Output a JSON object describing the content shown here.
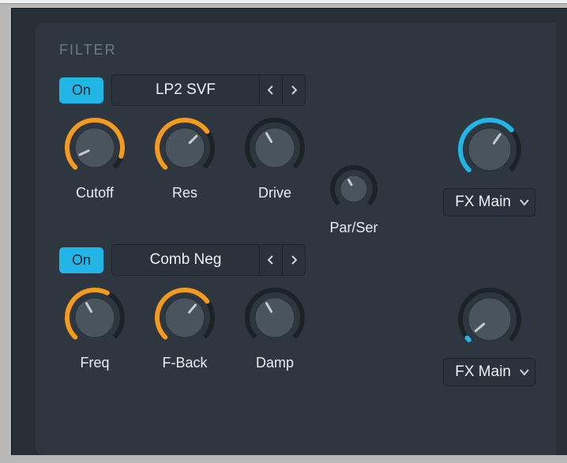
{
  "section_title": "FILTER",
  "filter1": {
    "on_label": "On",
    "type": "LP2 SVF",
    "knobs": {
      "cutoff": {
        "label": "Cutoff",
        "angle": -115,
        "color": "orange",
        "fill": 0.9
      },
      "res": {
        "label": "Res",
        "angle": 45,
        "color": "orange",
        "fill": 0.7
      },
      "drive": {
        "label": "Drive",
        "angle": -30,
        "color": "none",
        "fill": 0
      }
    }
  },
  "filter2": {
    "on_label": "On",
    "type": "Comb Neg",
    "knobs": {
      "freq": {
        "label": "Freq",
        "angle": -30,
        "color": "orange",
        "fill": 0.6
      },
      "fback": {
        "label": "F-Back",
        "angle": 40,
        "color": "orange",
        "fill": 0.7
      },
      "damp": {
        "label": "Damp",
        "angle": -30,
        "color": "none",
        "fill": 0
      }
    }
  },
  "par_ser": {
    "label": "Par/Ser",
    "angle": -30
  },
  "out1": {
    "label": "FX Main",
    "angle": 35,
    "color": "blue",
    "fill": 0.68
  },
  "out2": {
    "label": "FX Main",
    "angle": -130,
    "color": "blue",
    "fill": 0.02
  }
}
